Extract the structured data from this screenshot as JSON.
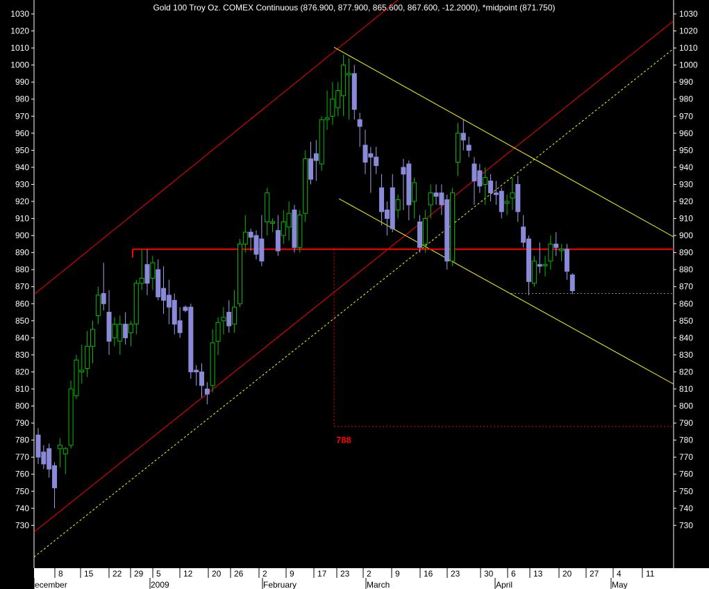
{
  "chart_data": {
    "type": "candlestick",
    "title": "Gold 100 Troy Oz. COMEX Continuous (876.900, 877.900, 865.600, 867.600, -12.2000), *midpoint (871.750)",
    "ylim": [
      720,
      1035
    ],
    "yticks": [
      730,
      740,
      750,
      760,
      770,
      780,
      790,
      800,
      810,
      820,
      830,
      840,
      850,
      860,
      870,
      880,
      890,
      900,
      910,
      920,
      930,
      940,
      950,
      960,
      970,
      980,
      990,
      1000,
      1010,
      1020,
      1030
    ],
    "x_tick_labels": [
      "8",
      "15",
      "22",
      "29",
      "5",
      "12",
      "20",
      "26",
      "2",
      "9",
      "17",
      "23",
      "2",
      "9",
      "16",
      "23",
      "30",
      "6",
      "13",
      "20",
      "27",
      "4",
      "11"
    ],
    "month_labels": [
      "ecember",
      "2009",
      "February",
      "March",
      "April",
      "May"
    ],
    "colors": {
      "up": "#00c000",
      "down": "#8a8ad8",
      "channel": "#ff0000",
      "midline": "#ffff00",
      "fork": "#ffff00",
      "support": "#ff0000"
    },
    "candles": [
      {
        "o": 783,
        "h": 787,
        "l": 766,
        "c": 770
      },
      {
        "o": 773,
        "h": 777,
        "l": 763,
        "c": 766
      },
      {
        "o": 775,
        "h": 778,
        "l": 758,
        "c": 763
      },
      {
        "o": 765,
        "h": 767,
        "l": 740,
        "c": 752
      },
      {
        "o": 775,
        "h": 781,
        "l": 764,
        "c": 777
      },
      {
        "o": 772,
        "h": 776,
        "l": 760,
        "c": 775
      },
      {
        "o": 777,
        "h": 815,
        "l": 775,
        "c": 810
      },
      {
        "o": 806,
        "h": 830,
        "l": 804,
        "c": 827
      },
      {
        "o": 820,
        "h": 836,
        "l": 813,
        "c": 821
      },
      {
        "o": 822,
        "h": 844,
        "l": 817,
        "c": 835
      },
      {
        "o": 835,
        "h": 850,
        "l": 825,
        "c": 845
      },
      {
        "o": 853,
        "h": 870,
        "l": 848,
        "c": 865
      },
      {
        "o": 866,
        "h": 884,
        "l": 856,
        "c": 860
      },
      {
        "o": 855,
        "h": 868,
        "l": 830,
        "c": 838
      },
      {
        "o": 840,
        "h": 852,
        "l": 835,
        "c": 848
      },
      {
        "o": 838,
        "h": 853,
        "l": 830,
        "c": 848
      },
      {
        "o": 848,
        "h": 855,
        "l": 836,
        "c": 840
      },
      {
        "o": 843,
        "h": 850,
        "l": 835,
        "c": 848
      },
      {
        "o": 848,
        "h": 874,
        "l": 842,
        "c": 872
      },
      {
        "o": 872,
        "h": 892,
        "l": 868,
        "c": 875
      },
      {
        "o": 883,
        "h": 892,
        "l": 865,
        "c": 872
      },
      {
        "o": 875,
        "h": 888,
        "l": 868,
        "c": 884
      },
      {
        "o": 880,
        "h": 886,
        "l": 862,
        "c": 864
      },
      {
        "o": 869,
        "h": 882,
        "l": 854,
        "c": 862
      },
      {
        "o": 865,
        "h": 874,
        "l": 848,
        "c": 858
      },
      {
        "o": 862,
        "h": 866,
        "l": 842,
        "c": 848
      },
      {
        "o": 850,
        "h": 858,
        "l": 840,
        "c": 843
      },
      {
        "o": 858,
        "h": 859,
        "l": 855,
        "c": 856
      },
      {
        "o": 858,
        "h": 860,
        "l": 816,
        "c": 820
      },
      {
        "o": 821,
        "h": 824,
        "l": 812,
        "c": 820
      },
      {
        "o": 820,
        "h": 825,
        "l": 805,
        "c": 812
      },
      {
        "o": 810,
        "h": 814,
        "l": 801,
        "c": 807
      },
      {
        "o": 812,
        "h": 845,
        "l": 808,
        "c": 837
      },
      {
        "o": 838,
        "h": 852,
        "l": 830,
        "c": 849
      },
      {
        "o": 850,
        "h": 858,
        "l": 842,
        "c": 852
      },
      {
        "o": 855,
        "h": 862,
        "l": 843,
        "c": 847
      },
      {
        "o": 848,
        "h": 868,
        "l": 843,
        "c": 858
      },
      {
        "o": 860,
        "h": 898,
        "l": 858,
        "c": 895
      },
      {
        "o": 895,
        "h": 912,
        "l": 890,
        "c": 902
      },
      {
        "o": 902,
        "h": 904,
        "l": 891,
        "c": 899
      },
      {
        "o": 900,
        "h": 903,
        "l": 886,
        "c": 889
      },
      {
        "o": 898,
        "h": 912,
        "l": 882,
        "c": 885
      },
      {
        "o": 908,
        "h": 928,
        "l": 900,
        "c": 925
      },
      {
        "o": 908,
        "h": 910,
        "l": 902,
        "c": 908
      },
      {
        "o": 903,
        "h": 912,
        "l": 888,
        "c": 891
      },
      {
        "o": 900,
        "h": 915,
        "l": 895,
        "c": 908
      },
      {
        "o": 905,
        "h": 920,
        "l": 897,
        "c": 913
      },
      {
        "o": 915,
        "h": 918,
        "l": 890,
        "c": 893
      },
      {
        "o": 893,
        "h": 915,
        "l": 890,
        "c": 912
      },
      {
        "o": 913,
        "h": 950,
        "l": 908,
        "c": 945
      },
      {
        "o": 945,
        "h": 955,
        "l": 930,
        "c": 933
      },
      {
        "o": 948,
        "h": 956,
        "l": 932,
        "c": 944
      },
      {
        "o": 942,
        "h": 970,
        "l": 938,
        "c": 968
      },
      {
        "o": 968,
        "h": 985,
        "l": 962,
        "c": 969
      },
      {
        "o": 970,
        "h": 990,
        "l": 965,
        "c": 980
      },
      {
        "o": 975,
        "h": 990,
        "l": 970,
        "c": 985
      },
      {
        "o": 982,
        "h": 1006,
        "l": 970,
        "c": 1000
      },
      {
        "o": 995,
        "h": 1004,
        "l": 968,
        "c": 995
      },
      {
        "o": 995,
        "h": 1000,
        "l": 968,
        "c": 974
      },
      {
        "o": 968,
        "h": 972,
        "l": 952,
        "c": 964
      },
      {
        "o": 953,
        "h": 962,
        "l": 936,
        "c": 943
      },
      {
        "o": 948,
        "h": 952,
        "l": 925,
        "c": 946
      },
      {
        "o": 946,
        "h": 952,
        "l": 936,
        "c": 941
      },
      {
        "o": 928,
        "h": 936,
        "l": 906,
        "c": 914
      },
      {
        "o": 915,
        "h": 920,
        "l": 900,
        "c": 910
      },
      {
        "o": 928,
        "h": 936,
        "l": 902,
        "c": 904
      },
      {
        "o": 915,
        "h": 924,
        "l": 910,
        "c": 921
      },
      {
        "o": 940,
        "h": 945,
        "l": 915,
        "c": 936
      },
      {
        "o": 942,
        "h": 944,
        "l": 909,
        "c": 918
      },
      {
        "o": 920,
        "h": 934,
        "l": 910,
        "c": 931
      },
      {
        "o": 908,
        "h": 912,
        "l": 890,
        "c": 893
      },
      {
        "o": 895,
        "h": 915,
        "l": 890,
        "c": 910
      },
      {
        "o": 918,
        "h": 930,
        "l": 910,
        "c": 925
      },
      {
        "o": 925,
        "h": 930,
        "l": 918,
        "c": 923
      },
      {
        "o": 925,
        "h": 930,
        "l": 912,
        "c": 918
      },
      {
        "o": 921,
        "h": 924,
        "l": 880,
        "c": 885
      },
      {
        "o": 885,
        "h": 928,
        "l": 882,
        "c": 925
      },
      {
        "o": 943,
        "h": 966,
        "l": 935,
        "c": 960
      },
      {
        "o": 960,
        "h": 968,
        "l": 950,
        "c": 956
      },
      {
        "o": 953,
        "h": 958,
        "l": 946,
        "c": 950
      },
      {
        "o": 942,
        "h": 946,
        "l": 918,
        "c": 932
      },
      {
        "o": 938,
        "h": 942,
        "l": 925,
        "c": 929
      },
      {
        "o": 930,
        "h": 940,
        "l": 918,
        "c": 934
      },
      {
        "o": 932,
        "h": 936,
        "l": 920,
        "c": 925
      },
      {
        "o": 925,
        "h": 932,
        "l": 918,
        "c": 924
      },
      {
        "o": 926,
        "h": 928,
        "l": 910,
        "c": 914
      },
      {
        "o": 919,
        "h": 924,
        "l": 912,
        "c": 920
      },
      {
        "o": 922,
        "h": 934,
        "l": 915,
        "c": 925
      },
      {
        "o": 930,
        "h": 935,
        "l": 908,
        "c": 914
      },
      {
        "o": 905,
        "h": 912,
        "l": 893,
        "c": 896
      },
      {
        "o": 898,
        "h": 900,
        "l": 865,
        "c": 873
      },
      {
        "o": 872,
        "h": 888,
        "l": 870,
        "c": 885
      },
      {
        "o": 883,
        "h": 896,
        "l": 878,
        "c": 882
      },
      {
        "o": 883,
        "h": 888,
        "l": 876,
        "c": 883
      },
      {
        "o": 885,
        "h": 900,
        "l": 880,
        "c": 895
      },
      {
        "o": 895,
        "h": 902,
        "l": 888,
        "c": 893
      },
      {
        "o": 892,
        "h": 895,
        "l": 885,
        "c": 892
      },
      {
        "o": 892,
        "h": 895,
        "l": 874,
        "c": 879
      },
      {
        "o": 876.9,
        "h": 877.9,
        "l": 865.6,
        "c": 867.6
      }
    ],
    "annotations": [
      {
        "text": "788",
        "value": 788,
        "color": "#ff0000"
      }
    ],
    "support_level": 892,
    "dotted_levels": [
      866,
      788
    ]
  }
}
